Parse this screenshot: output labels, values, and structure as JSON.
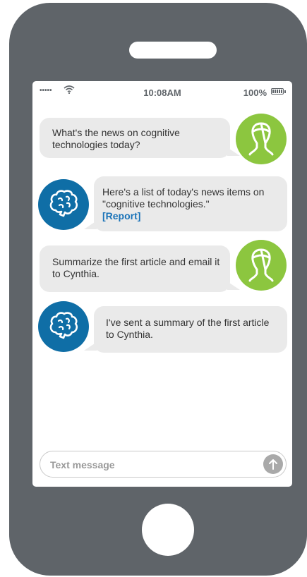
{
  "status_bar": {
    "signal": "•••••",
    "time": "10:08AM",
    "battery_percent": "100%"
  },
  "messages": [
    {
      "sender": "user",
      "text": "What's the news on cognitive technologies today?"
    },
    {
      "sender": "bot",
      "text": "Here's a list of today's news items on \"cognitive technologies.\"",
      "link": "[Report]"
    },
    {
      "sender": "user",
      "text": "Summarize the first article and email it to Cynthia."
    },
    {
      "sender": "bot",
      "text": "I've sent a summary of the first article to Cynthia."
    }
  ],
  "input": {
    "placeholder": "Text message"
  },
  "colors": {
    "phone_body": "#5f6469",
    "user_avatar": "#8cc63f",
    "bot_avatar": "#0f6ea6",
    "bubble": "#eaeaea",
    "link": "#1a73b8",
    "send_button": "#a9a9a9"
  },
  "icons": {
    "user_avatar": "person-head-icon",
    "bot_avatar": "brain-icon",
    "send": "arrow-up-icon",
    "wifi": "wifi-icon",
    "battery": "battery-icon"
  }
}
